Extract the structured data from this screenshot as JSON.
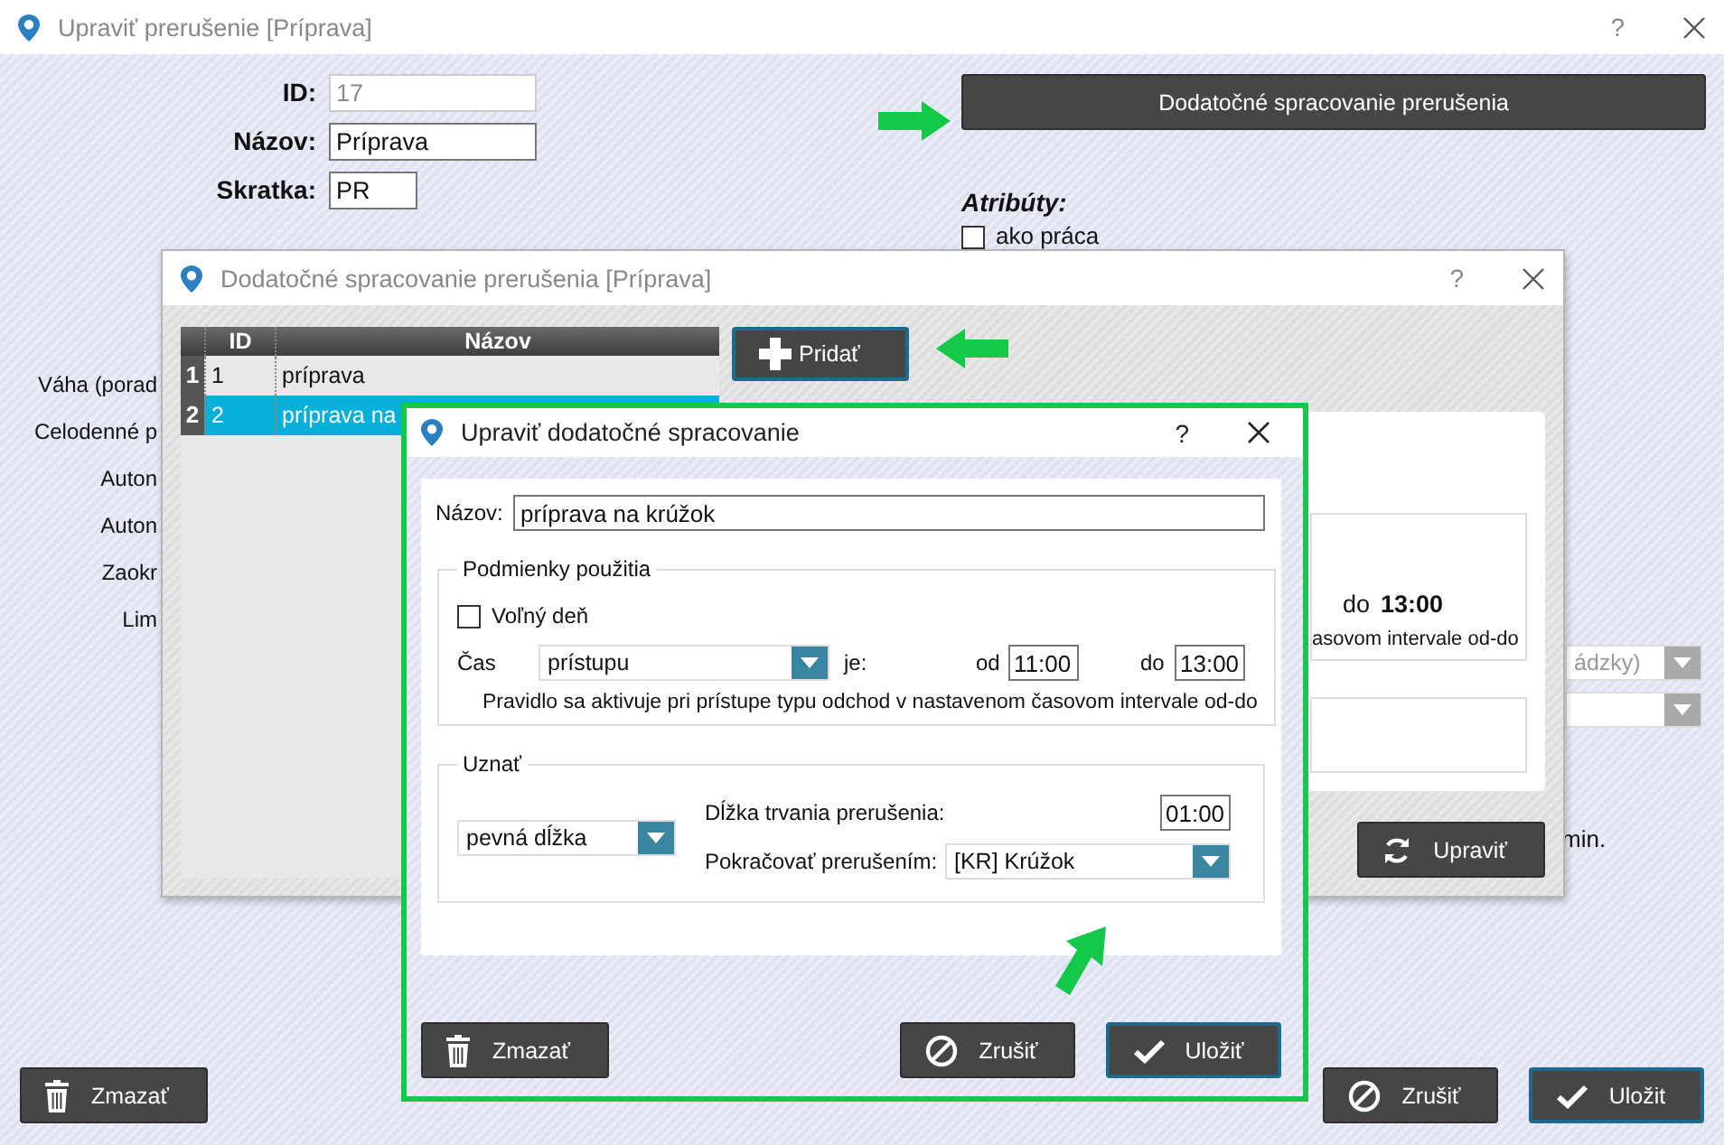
{
  "window": {
    "title": "Upraviť prerušenie [Príprava]",
    "help": "?"
  },
  "form": {
    "fields": [
      {
        "label": "ID:",
        "value": "17",
        "disabled": true
      },
      {
        "label": "Názov:",
        "value": "Príprava",
        "disabled": false
      },
      {
        "label": "Skratka:",
        "value": "PR",
        "disabled": false
      }
    ]
  },
  "extra_button": "Dodatočné spracovanie prerušenia",
  "attributes": {
    "title": "Atribúty:",
    "checkboxes": [
      {
        "label": "ako práca",
        "checked": false
      }
    ]
  },
  "left_labels": [
    "Váha (porad",
    "Celodenné p",
    "Auton",
    "Auton",
    "Zaokr",
    "Lim"
  ],
  "right_selects": [
    {
      "value": "ádzky)",
      "disabled": true
    },
    {
      "disabled": true
    }
  ],
  "min_label": "min.",
  "buttons": [
    {
      "kind": "delete",
      "label": "Zmazať"
    },
    {
      "kind": "cancel",
      "label": "Zrušiť"
    },
    {
      "kind": "save",
      "label": "Uložit"
    }
  ],
  "extra_dialog": {
    "title": "Dodatočné spracovanie prerušenia [Príprava]",
    "help": "?",
    "table": {
      "columns": [
        "ID",
        "Názov"
      ],
      "rows": [
        {
          "num": "1",
          "id": "1",
          "name": "príprava",
          "selected": false
        },
        {
          "num": "2",
          "id": "2",
          "name": "príprava na",
          "selected": true
        }
      ]
    },
    "add_button": {
      "kind": "add",
      "label": "Pridať"
    },
    "panel": {
      "time_label": "do",
      "time": "13:00",
      "note": "asovom intervale od-do"
    },
    "edit_button": {
      "kind": "edit",
      "label": "Upraviť"
    }
  },
  "edit_dialog": {
    "title": "Upraviť dodatočné spracovanie",
    "help": "?",
    "name_label": "Názov:",
    "name_value": "príprava na krúžok",
    "conditions": {
      "title": "Podmienky použitia",
      "free_day": {
        "label": "Voľný deň",
        "checked": false
      },
      "time_label": "Čas",
      "time_type": "prístupu",
      "is_label": "je:",
      "from_label": "od",
      "from": "11:00",
      "to_label": "do",
      "to": "13:00",
      "rule": "Pravidlo sa aktivuje pri prístupe typu odchod v nastavenom časovom intervale od-do"
    },
    "recognize": {
      "title": "Uznať",
      "mode": "pevná dĺžka",
      "duration_label": "Dĺžka trvania prerušenia:",
      "duration": "01:00",
      "continue_label": "Pokračovať prerušením:",
      "continue_value": "[KR] Krúžok"
    },
    "buttons": [
      {
        "kind": "delete",
        "label": "Zmazať"
      },
      {
        "kind": "cancel",
        "label": "Zrušiť"
      },
      {
        "kind": "save",
        "label": "Uložiť"
      }
    ]
  }
}
